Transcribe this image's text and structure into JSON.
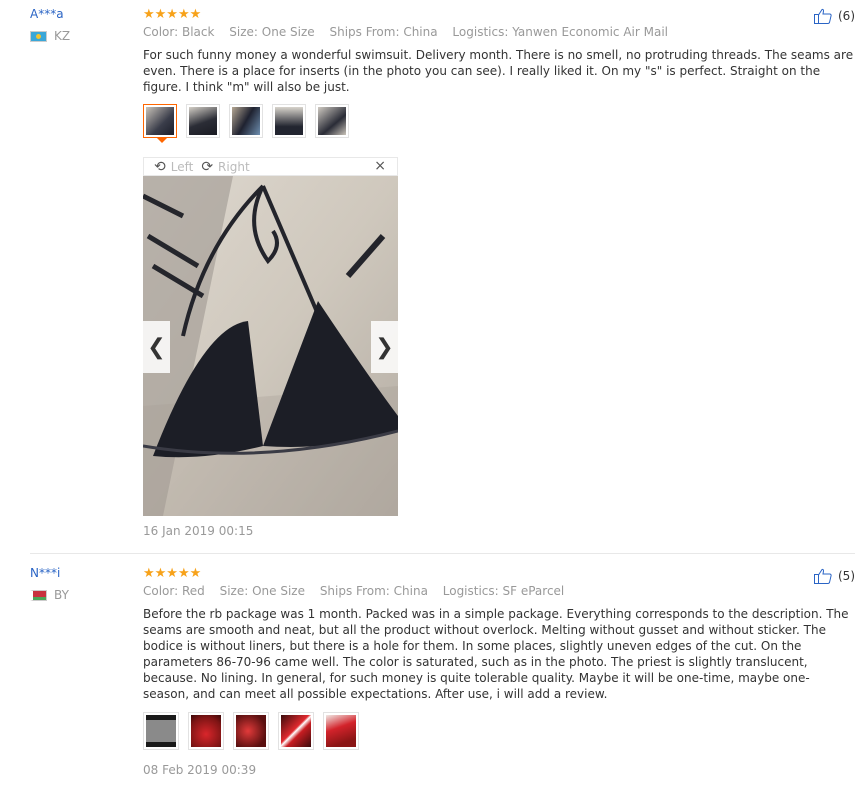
{
  "reviews": [
    {
      "user": "A***a",
      "country": "KZ",
      "rating": 5,
      "stars": "★★★★★",
      "helpful_count": "(6)",
      "meta": {
        "color": "Color: Black",
        "size": "Size: One Size",
        "ships_from": "Ships From: China",
        "logistics": "Logistics: Yanwen Economic Air Mail"
      },
      "text": "For such funny money a wonderful swimsuit. Delivery month. There is no smell, no protruding threads. The seams are even. There is a place for inserts (in the photo you can see). I really liked it. On my \"s\" is perfect. Straight on the figure. I think \"m\" will also be just.",
      "viewer": {
        "left_label": "Left",
        "right_label": "Right",
        "close": "×"
      },
      "date": "16 Jan 2019 00:15"
    },
    {
      "user": "N***i",
      "country": "BY",
      "rating": 5,
      "stars": "★★★★★",
      "helpful_count": "(5)",
      "meta": {
        "color": "Color: Red",
        "size": "Size: One Size",
        "ships_from": "Ships From: China",
        "logistics": "Logistics: SF eParcel"
      },
      "text": "Before the rb package was 1 month. Packed was in a simple package. Everything corresponds to the description. The seams are smooth and neat, but all the product without overlock. Melting without gusset and without sticker. The bodice is without liners, but there is a hole for them. In some places, slightly uneven edges of the cut. On the parameters 86-70-96 came well. The color is saturated, such as in the photo. The priest is slightly translucent, because. No lining. In general, for such money is quite tolerable quality. Maybe it will be one-time, maybe one-season, and can meet all possible expectations. After use, i will add a review.",
      "date": "08 Feb 2019 00:39"
    }
  ],
  "colors": {
    "user_link": "#2a64c5",
    "star": "#f7a21a",
    "active_thumb": "#ff6600"
  }
}
